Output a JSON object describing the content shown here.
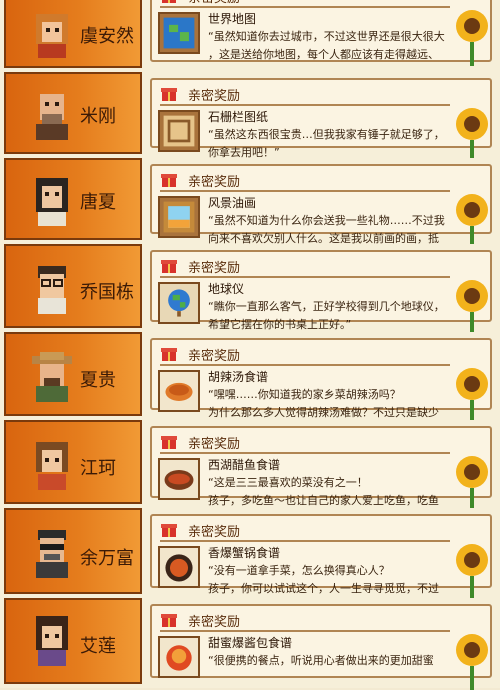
{
  "reward_header": "亲密奖励",
  "rows": [
    {
      "name": "虞安然",
      "item": "世界地图",
      "line1": "“虽然知道你去过城市，不过这世界还是很大很大",
      "line2": "，这是送给你地图，每个人都应该有走得越远、"
    },
    {
      "name": "米刚",
      "item": "石栅栏图纸",
      "line1": "“虽然这东西很宝贵…但我我家有锤子就足够了，",
      "line2": "你拿去用吧！”"
    },
    {
      "name": "唐夏",
      "item": "风景油画",
      "line1": "“虽然不知道为什么你会送我一些礼物……不过我",
      "line2": "向来不喜欢欠别人什么。这是我以前画的画，抵"
    },
    {
      "name": "乔国栋",
      "item": "地球仪",
      "line1": "“瞧你一直那么客气，正好学校得到几个地球仪，",
      "line2": "希望它摆在你的书桌上正好。”"
    },
    {
      "name": "夏贵",
      "item": "胡辣汤食谱",
      "line1": "“嘿嘿……你知道我的家乡菜胡辣汤吗？",
      "line2": "为什么那么多人觉得胡辣汤难做？不过只是缺少"
    },
    {
      "name": "江珂",
      "item": "西湖醋鱼食谱",
      "line1": "“这是三三最喜欢的菜没有之一！",
      "line2": "孩子，多吃鱼～也让自己的家人爱上吃鱼，吃鱼"
    },
    {
      "name": "余万富",
      "item": "香爆蟹锅食谱",
      "line1": "“没有一道拿手菜，怎么换得真心人？",
      "line2": "孩子，你可以试试这个，人一生寻寻觅觅，不过"
    },
    {
      "name": "艾莲",
      "item": "甜蜜爆酱包食谱",
      "line1": "“很便携的餐点，听说用心者做出来的更加甜蜜",
      "line2": ""
    }
  ],
  "colors": {
    "panel": "#e57d1d",
    "card": "#fbf4e2",
    "border": "#b08553"
  }
}
